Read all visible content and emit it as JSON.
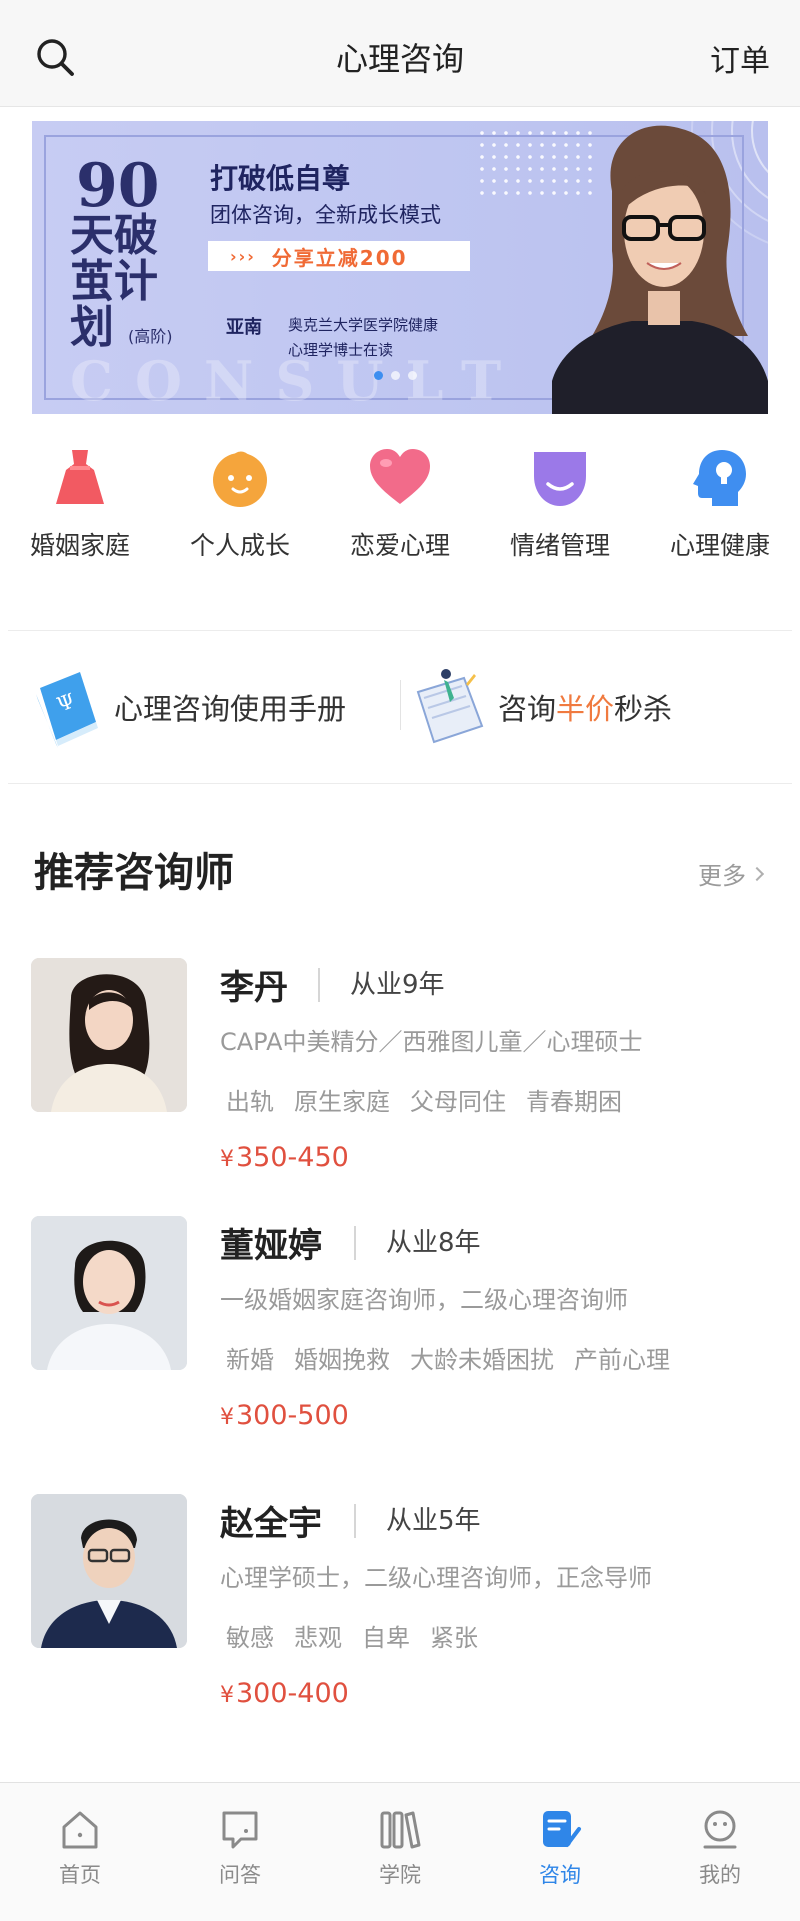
{
  "header": {
    "title": "心理咨询",
    "orders_label": "订单",
    "search_icon": "search-icon"
  },
  "banner": {
    "big_number": "90",
    "plan_text": "天破茧计划",
    "plan_sub": "(高阶)",
    "headline": "打破低自尊",
    "subline": "团体咨询，全新成长模式",
    "promo_arrows": "›››",
    "promo": "分享立减200",
    "speaker": "亚南",
    "credentials_line1": "奥克兰大学医学院健康",
    "credentials_line2": "心理学博士在读",
    "watermark": "CONSULT",
    "pager": {
      "count": 3,
      "active_index": 0
    }
  },
  "categories": [
    {
      "label": "婚姻家庭",
      "icon": "dress-icon",
      "color": "#f25a62"
    },
    {
      "label": "个人成长",
      "icon": "baby-face-icon",
      "color": "#f5a53c"
    },
    {
      "label": "恋爱心理",
      "icon": "heart-icon",
      "color": "#f26b8a"
    },
    {
      "label": "情绪管理",
      "icon": "smile-mask-icon",
      "color": "#9b79e8"
    },
    {
      "label": "心理健康",
      "icon": "head-profile-icon",
      "color": "#3f8ef0"
    }
  ],
  "features": {
    "manual": {
      "label": "心理咨询使用手册",
      "icon": "book-icon"
    },
    "flash_sale": {
      "prefix": "咨询",
      "highlight": "半价",
      "suffix": "秒杀",
      "icon": "notebook-illustration-icon"
    }
  },
  "recommended": {
    "title": "推荐咨询师",
    "more_label": "更多",
    "counselors": [
      {
        "name": "李丹",
        "years": "从业9年",
        "credentials": "CAPA中美精分／西雅图儿童／心理硕士",
        "tags": [
          "出轨",
          "原生家庭",
          "父母同住",
          "青春期困"
        ],
        "currency": "¥",
        "price": "350-450"
      },
      {
        "name": "董娅婷",
        "years": "从业8年",
        "credentials": "一级婚姻家庭咨询师，二级心理咨询师",
        "tags": [
          "新婚",
          "婚姻挽救",
          "大龄未婚困扰",
          "产前心理"
        ],
        "currency": "¥",
        "price": "300-500"
      },
      {
        "name": "赵全宇",
        "years": "从业5年",
        "credentials": "心理学硕士，二级心理咨询师，正念导师",
        "tags": [
          "敏感",
          "悲观",
          "自卑",
          "紧张"
        ],
        "currency": "¥",
        "price": "300-400"
      }
    ]
  },
  "tabbar": {
    "items": [
      {
        "label": "首页",
        "icon": "home-icon",
        "active": false
      },
      {
        "label": "问答",
        "icon": "qa-bubble-icon",
        "active": false
      },
      {
        "label": "学院",
        "icon": "books-icon",
        "active": false
      },
      {
        "label": "咨询",
        "icon": "consult-note-icon",
        "active": true
      },
      {
        "label": "我的",
        "icon": "profile-face-icon",
        "active": false
      }
    ]
  },
  "colors": {
    "accent_blue": "#2f86e8",
    "price_red": "#e0503f",
    "highlight_orange": "#f07a3f"
  }
}
